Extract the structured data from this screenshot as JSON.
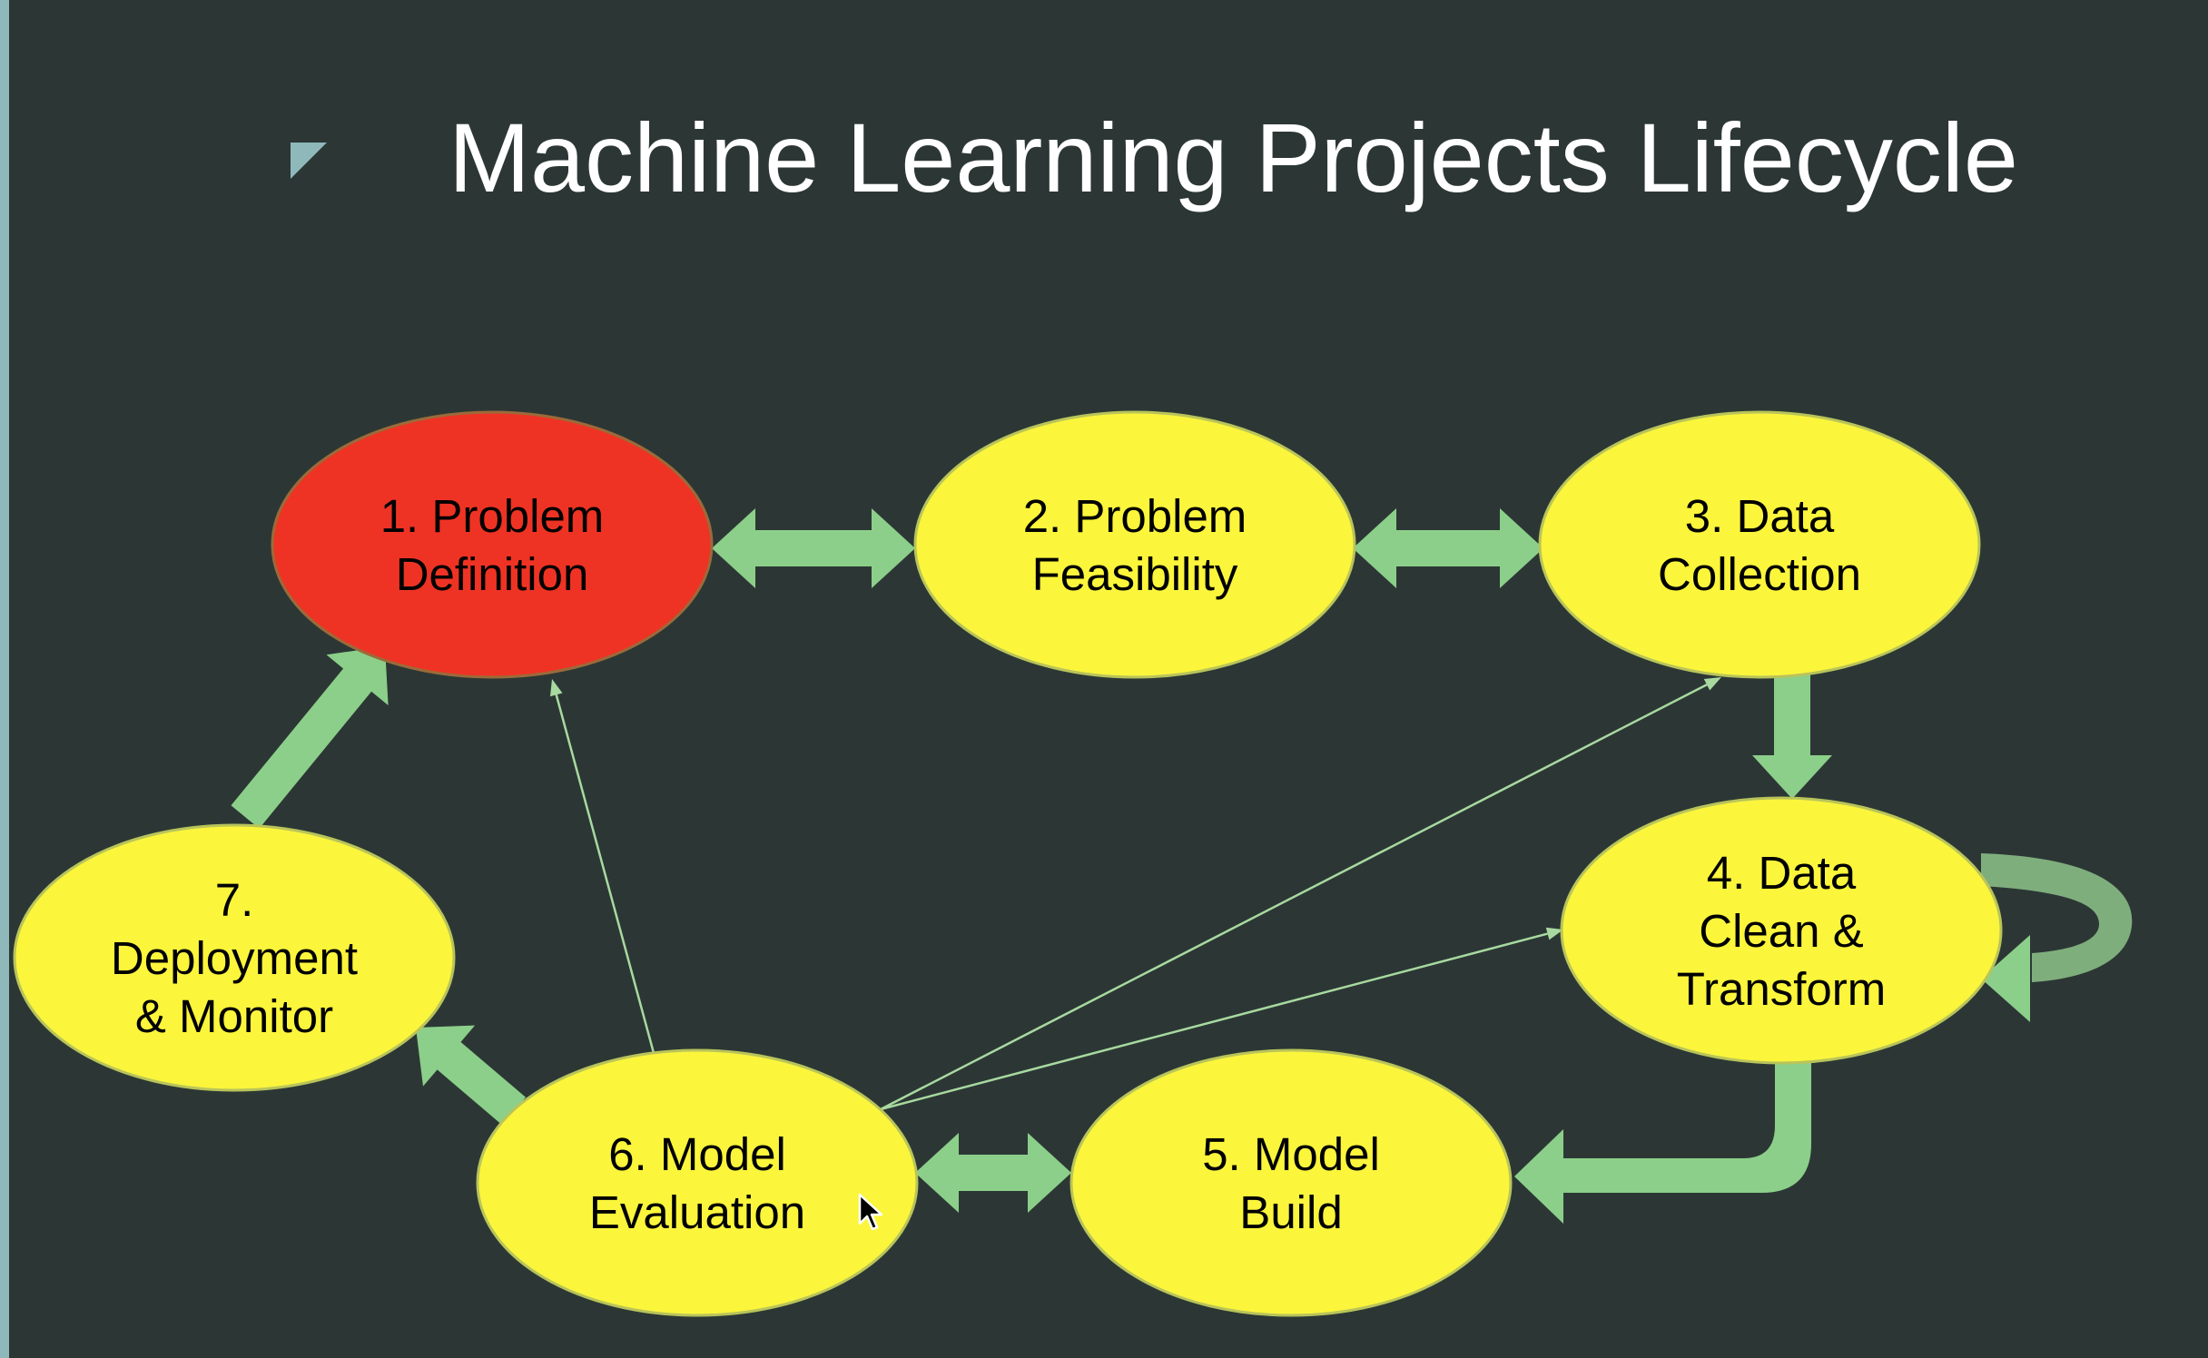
{
  "slide": {
    "title": "Machine Learning Projects Lifecycle"
  },
  "colors": {
    "background": "#2c3735",
    "active_stage": "#ee3324",
    "stage": "#fbf53c",
    "arrow": "#8ccf8a",
    "thin_arrow": "#a8d9a0",
    "title_text": "#ffffff"
  },
  "stages": [
    {
      "id": "problem-definition",
      "lines": [
        "1. Problem",
        "Definition"
      ],
      "active": true
    },
    {
      "id": "problem-feasibility",
      "lines": [
        "2. Problem",
        "Feasibility"
      ],
      "active": false
    },
    {
      "id": "data-collection",
      "lines": [
        "3. Data",
        "Collection"
      ],
      "active": false
    },
    {
      "id": "data-clean-transform",
      "lines": [
        "4. Data",
        "Clean &",
        "Transform"
      ],
      "active": false
    },
    {
      "id": "model-build",
      "lines": [
        "5. Model",
        "Build"
      ],
      "active": false
    },
    {
      "id": "model-evaluation",
      "lines": [
        "6. Model",
        "Evaluation"
      ],
      "active": false
    },
    {
      "id": "deployment-monitor",
      "lines": [
        "7.",
        "Deployment",
        "& Monitor"
      ],
      "active": false
    }
  ],
  "connections": [
    {
      "from": "problem-definition",
      "to": "problem-feasibility",
      "style": "thick",
      "direction": "both"
    },
    {
      "from": "problem-feasibility",
      "to": "data-collection",
      "style": "thick",
      "direction": "both"
    },
    {
      "from": "data-collection",
      "to": "data-clean-transform",
      "style": "thick",
      "direction": "forward"
    },
    {
      "from": "data-clean-transform",
      "to": "data-clean-transform",
      "style": "thick-loop",
      "direction": "forward"
    },
    {
      "from": "data-clean-transform",
      "to": "model-build",
      "style": "thick-elbow",
      "direction": "forward"
    },
    {
      "from": "model-build",
      "to": "model-evaluation",
      "style": "thick",
      "direction": "both"
    },
    {
      "from": "model-evaluation",
      "to": "deployment-monitor",
      "style": "thick",
      "direction": "forward"
    },
    {
      "from": "deployment-monitor",
      "to": "problem-definition",
      "style": "thick",
      "direction": "forward"
    },
    {
      "from": "model-evaluation",
      "to": "problem-definition",
      "style": "thin",
      "direction": "forward"
    },
    {
      "from": "model-evaluation",
      "to": "data-collection",
      "style": "thin",
      "direction": "forward"
    },
    {
      "from": "model-evaluation",
      "to": "data-clean-transform",
      "style": "thin",
      "direction": "forward"
    }
  ],
  "icons": {
    "bullet": "triangle-bullet-icon",
    "cursor": "mouse-pointer-icon"
  }
}
